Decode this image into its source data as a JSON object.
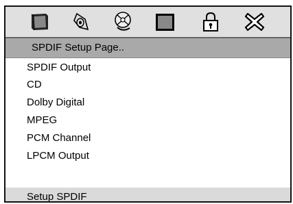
{
  "toolbar": {
    "icons": [
      {
        "name": "tv-screen-icon"
      },
      {
        "name": "audio-speaker-icon"
      },
      {
        "name": "disc-icon"
      },
      {
        "name": "video-screen-icon"
      },
      {
        "name": "lock-icon"
      },
      {
        "name": "exit-icon"
      }
    ]
  },
  "title": "SPDIF Setup Page..",
  "menu": {
    "items": [
      {
        "label": "SPDIF Output"
      },
      {
        "label": "CD"
      },
      {
        "label": "Dolby Digital"
      },
      {
        "label": "MPEG"
      },
      {
        "label": "PCM Channel"
      },
      {
        "label": "LPCM Output"
      }
    ]
  },
  "status": "Setup SPDIF",
  "colors": {
    "icon_bar": "#e0e0e0",
    "title_bar": "#a9a9a9",
    "status_bar": "#dadada"
  }
}
